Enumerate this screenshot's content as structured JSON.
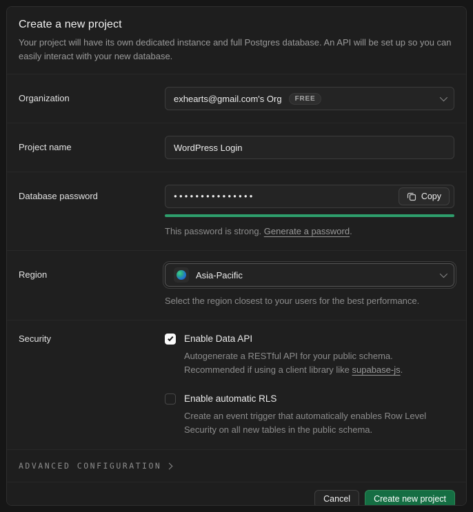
{
  "dialog": {
    "title": "Create a new project",
    "description": "Your project will have its own dedicated instance and full Postgres database. An API will be set up so you can easily interact with your new database."
  },
  "form": {
    "organization": {
      "label": "Organization",
      "value": "exhearts@gmail.com's Org",
      "badge": "FREE"
    },
    "project_name": {
      "label": "Project name",
      "value": "WordPress Login"
    },
    "database_password": {
      "label": "Database password",
      "masked_value": "●●●●●●●●●●●●●●●",
      "copy_label": "Copy",
      "hint_before_link": "This password is strong. ",
      "generate_link": "Generate a password",
      "hint_after_link": "."
    },
    "region": {
      "label": "Region",
      "value": "Asia-Pacific",
      "hint": "Select the region closest to your users for the best performance."
    },
    "security": {
      "label": "Security",
      "options": [
        {
          "label": "Enable Data API",
          "checked": true,
          "desc_before_link": "Autogenerate a RESTful API for your public schema. Recommended if using a client library like ",
          "desc_link": "supabase-js",
          "desc_after_link": "."
        },
        {
          "label": "Enable automatic RLS",
          "checked": false,
          "description": "Create an event trigger that automatically enables Row Level Security on all new tables in the public schema."
        }
      ]
    }
  },
  "advanced": {
    "label": "ADVANCED CONFIGURATION"
  },
  "footer": {
    "cancel_label": "Cancel",
    "submit_label": "Create new project"
  },
  "colors": {
    "strength": "#2e9e6c",
    "brand-button": "#156e43",
    "brand-button-border": "#2e8a57"
  }
}
